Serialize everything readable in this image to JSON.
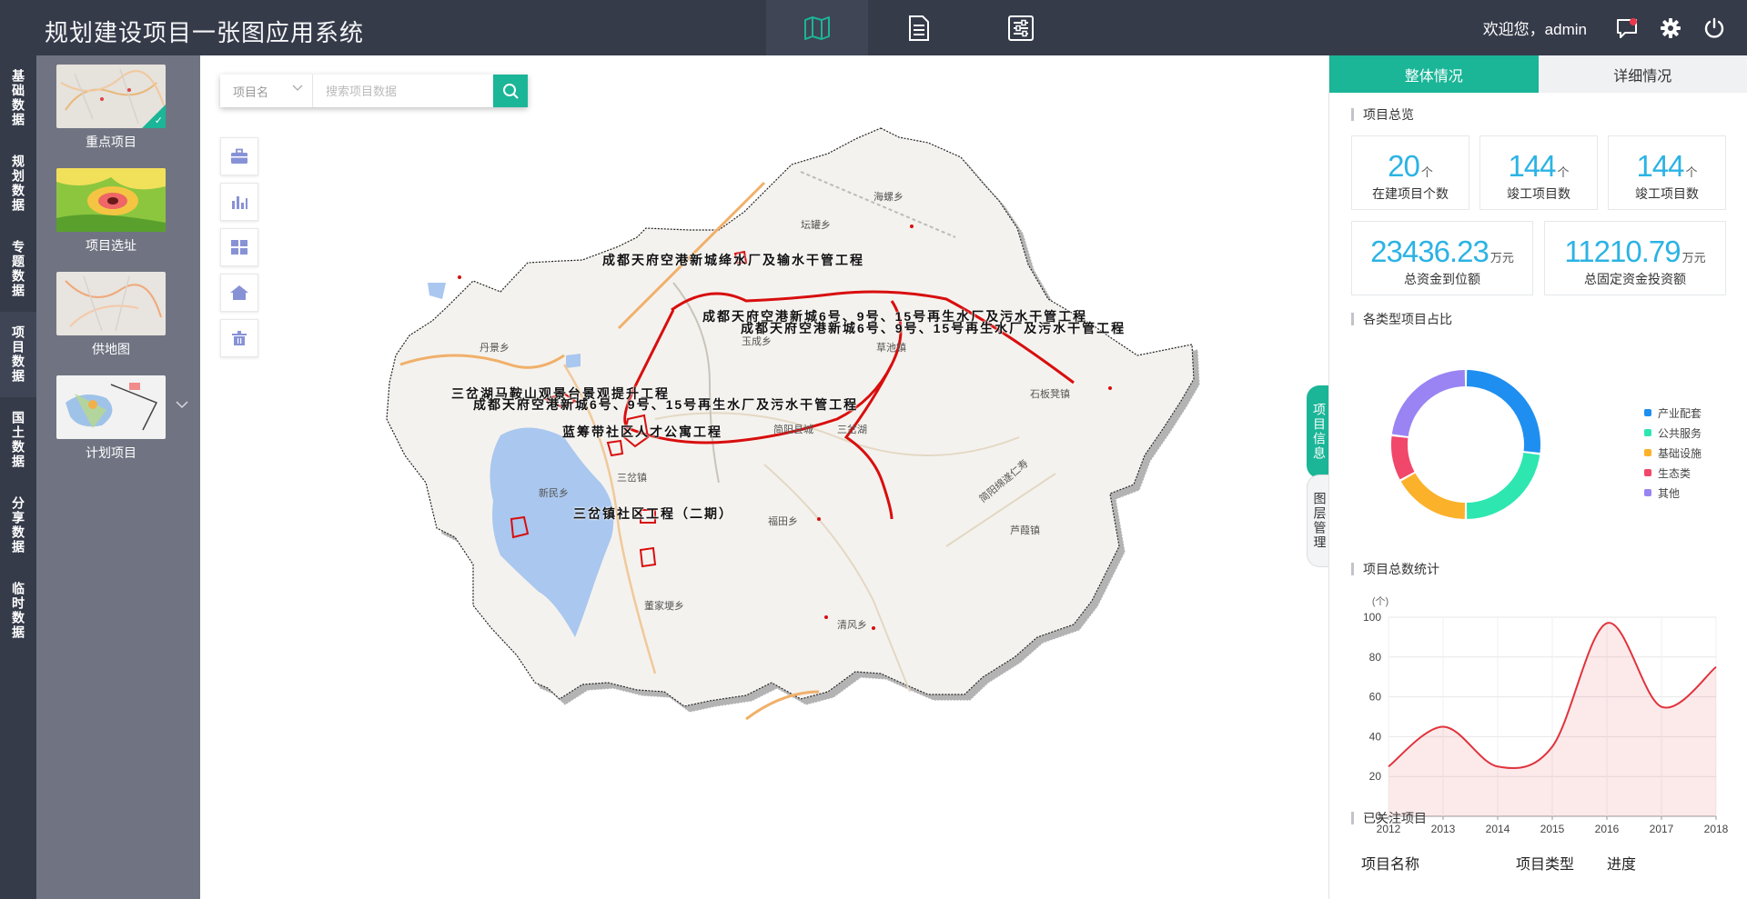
{
  "header": {
    "title": "规划建设项目一张图应用系统",
    "welcome": "欢迎您，admin",
    "nav": [
      {
        "icon": "map-icon",
        "active": true
      },
      {
        "icon": "list-icon",
        "active": false
      },
      {
        "icon": "sliders-icon",
        "active": false
      }
    ]
  },
  "categories": [
    "基础数据",
    "规划数据",
    "专题数据",
    "项目数据",
    "国土数据",
    "分享数据",
    "临时数据"
  ],
  "thumbnails": [
    {
      "label": "重点项目",
      "selected": true
    },
    {
      "label": "项目选址",
      "selected": false
    },
    {
      "label": "供地图",
      "selected": false
    },
    {
      "label": "计划项目",
      "selected": false
    }
  ],
  "search": {
    "category": "项目名",
    "placeholder": "搜索项目数据"
  },
  "map": {
    "project_labels": [
      "成都天府空港新城绛水厂及输水干管工程",
      "成都天府空港新城6号、9号、15号再生水厂及污水干管工程",
      "成都天府空港新城6号、9号、15号再生水厂及污水干管工程",
      "三岔湖马鞍山观景台景观提升工程",
      "成都天府空港新城6号、9号、15号再生水厂及污水干管工程",
      "蓝筹带社区人才公寓工程",
      "三岔镇社区工程（二期）"
    ],
    "town_labels": [
      "海螺乡",
      "坛罐乡",
      "丹景乡",
      "玉成乡",
      "草池镇",
      "石板凳镇",
      "简阳县城",
      "三岔湖",
      "新民乡",
      "三岔镇",
      "福田乡",
      "芦葭镇",
      "董家埂乡",
      "清风乡",
      "简阳绵遂仁寿"
    ]
  },
  "side_tabs": [
    "项目信息",
    "图层管理"
  ],
  "panel": {
    "tabs": [
      "整体情况",
      "详细情况"
    ],
    "overview_title": "项目总览",
    "stats": [
      {
        "value": "20",
        "unit": "个",
        "label": "在建项目个数"
      },
      {
        "value": "144",
        "unit": "个",
        "label": "竣工项目数"
      },
      {
        "value": "144",
        "unit": "个",
        "label": "竣工项目数"
      },
      {
        "value": "23436.23",
        "unit": "万元",
        "label": "总资金到位额"
      },
      {
        "value": "11210.79",
        "unit": "万元",
        "label": "总固定资金投资额"
      }
    ],
    "pie_title": "各类型项目占比",
    "line_title": "项目总数统计",
    "followed_title": "已关注项目",
    "table_headers": [
      "项目名称",
      "项目类型",
      "进度"
    ]
  },
  "chart_data": [
    {
      "type": "pie",
      "title": "各类型项目占比",
      "labels": [
        "产业配套",
        "公共服务",
        "基础设施",
        "生态类",
        "其他"
      ],
      "values": [
        27,
        23,
        17,
        10,
        23
      ],
      "colors": [
        "#1e8ff0",
        "#2ee6b0",
        "#fcb12a",
        "#f0476a",
        "#9a83f2"
      ],
      "legend": "right"
    },
    {
      "type": "line",
      "title": "项目总数统计",
      "ylabel": "(个)",
      "x": [
        "2012",
        "2013",
        "2014",
        "2015",
        "2016",
        "2017",
        "2018"
      ],
      "y": [
        25,
        45,
        25,
        35,
        97,
        55,
        75
      ],
      "ylim": [
        0,
        100
      ],
      "yticks": [
        0,
        20,
        40,
        60,
        80,
        100
      ],
      "color": "#e0333c",
      "grid": true
    }
  ]
}
